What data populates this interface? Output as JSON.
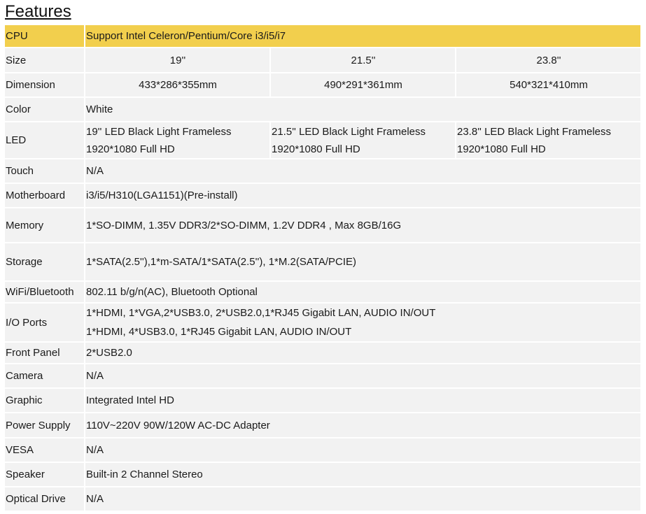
{
  "title": "Features",
  "header": {
    "label": "CPU",
    "value": "Support Intel Celeron/Pentium/Core i3/i5/i7"
  },
  "size": {
    "label": "Size",
    "values": [
      "19''",
      "21.5''",
      "23.8''"
    ]
  },
  "dimension": {
    "label": "Dimension",
    "values": [
      "433*286*355mm",
      "490*291*361mm",
      "540*321*410mm"
    ]
  },
  "color": {
    "label": "Color",
    "value": "White"
  },
  "led": {
    "label": "LED",
    "values": [
      {
        "line1": "19'' LED Black Light Frameless",
        "line2": "1920*1080 Full HD"
      },
      {
        "line1": "21.5'' LED Black Light Frameless",
        "line2": "1920*1080 Full HD"
      },
      {
        "line1": "23.8'' LED Black Light Frameless",
        "line2": "1920*1080 Full HD"
      }
    ]
  },
  "touch": {
    "label": "Touch",
    "value": "N/A"
  },
  "motherboard": {
    "label": "Motherboard",
    "value": "i3/i5/H310(LGA1151)(Pre-install)"
  },
  "memory": {
    "label": "Memory",
    "value": "1*SO-DIMM, 1.35V DDR3/2*SO-DIMM, 1.2V DDR4 , Max 8GB/16G"
  },
  "storage": {
    "label": "Storage",
    "value": "1*SATA(2.5''),1*m-SATA/1*SATA(2.5''), 1*M.2(SATA/PCIE)"
  },
  "wifi": {
    "label": "WiFi/Bluetooth",
    "value": "802.11 b/g/n(AC), Bluetooth Optional"
  },
  "io": {
    "label": "I/O Ports",
    "line1": "1*HDMI,  1*VGA,2*USB3.0, 2*USB2.0,1*RJ45 Gigabit LAN, AUDIO IN/OUT",
    "line2": "1*HDMI, 4*USB3.0, 1*RJ45 Gigabit LAN, AUDIO IN/OUT"
  },
  "front_panel": {
    "label": "Front Panel",
    "value": "2*USB2.0"
  },
  "camera": {
    "label": "Camera",
    "value": "N/A"
  },
  "graphic": {
    "label": "Graphic",
    "value": "Integrated Intel HD"
  },
  "power": {
    "label": "Power Supply",
    "value": "110V~220V 90W/120W AC-DC Adapter"
  },
  "vesa": {
    "label": "VESA",
    "value": "N/A"
  },
  "speaker": {
    "label": "Speaker",
    "value": "Built-in 2 Channel Stereo"
  },
  "optical": {
    "label": "Optical Drive",
    "value": "N/A"
  }
}
